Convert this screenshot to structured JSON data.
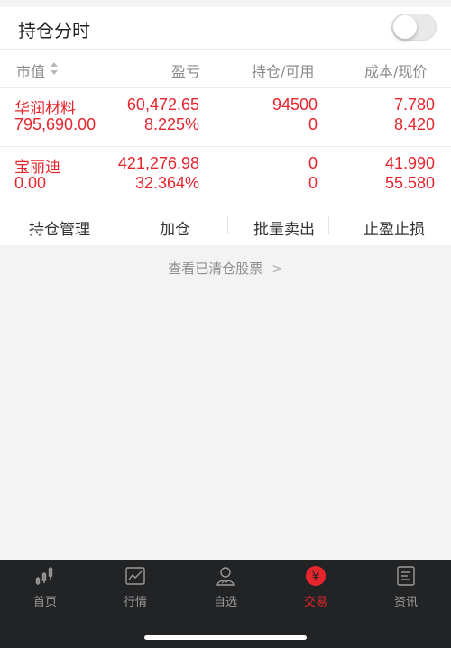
{
  "header": {
    "title": "持仓分时"
  },
  "columns": {
    "market_value": "市值",
    "profit_loss": "盈亏",
    "position_available": "持仓/可用",
    "cost_price": "成本/现价"
  },
  "holdings": [
    {
      "name": "华润材料",
      "market_value": "795,690.00",
      "profit": "60,472.65",
      "profit_pct": "8.225%",
      "position": "94500",
      "available": "0",
      "cost": "7.780",
      "price": "8.420"
    },
    {
      "name": "宝丽迪",
      "market_value": "0.00",
      "profit": "421,276.98",
      "profit_pct": "32.364%",
      "position": "0",
      "available": "0",
      "cost": "41.990",
      "price": "55.580"
    }
  ],
  "actions": {
    "manage": "持仓管理",
    "add": "加仓",
    "batch_sell": "批量卖出",
    "take_profit_stop_loss": "止盈止损"
  },
  "view_cleared": "查看已清仓股票",
  "tabs": [
    {
      "label": "首页",
      "icon": "candlestick-icon"
    },
    {
      "label": "行情",
      "icon": "line-chart-icon"
    },
    {
      "label": "自选",
      "icon": "user-chart-icon"
    },
    {
      "label": "交易",
      "icon": "yen-icon",
      "active": true
    },
    {
      "label": "资讯",
      "icon": "document-icon"
    }
  ],
  "colors": {
    "accent": "#e7252c",
    "tabbar": "#222325"
  }
}
